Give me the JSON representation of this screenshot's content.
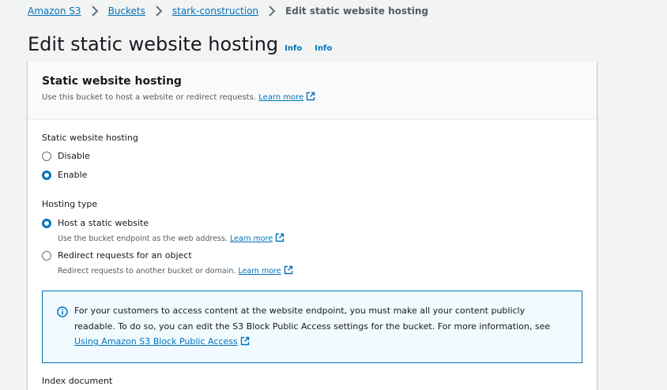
{
  "breadcrumb": {
    "items": [
      "Amazon S3",
      "Buckets",
      "stark-construction"
    ],
    "current": "Edit static website hosting"
  },
  "page": {
    "title": "Edit static website hosting",
    "info_links": [
      "Info",
      "Info"
    ]
  },
  "panel": {
    "title": "Static website hosting",
    "description": "Use this bucket to host a website or redirect requests.",
    "learn_more": "Learn more"
  },
  "hosting": {
    "label": "Static website hosting",
    "options": [
      "Disable",
      "Enable"
    ],
    "selected": "Enable"
  },
  "hosting_type": {
    "label": "Hosting type",
    "options": [
      {
        "label": "Host a static website",
        "desc": "Use the bucket endpoint as the web address.",
        "link": "Learn more"
      },
      {
        "label": "Redirect requests for an object",
        "desc": "Redirect requests to another bucket or domain.",
        "link": "Learn more"
      }
    ],
    "selected": "Host a static website"
  },
  "alert": {
    "text": "For your customers to access content at the website endpoint, you must make all your content publicly readable. To do so, you can edit the S3 Block Public Access settings for the bucket. For more information, see",
    "link": "Using Amazon S3 Block Public Access"
  },
  "index_document": {
    "label": "Index document"
  },
  "colors": {
    "link": "#0073bb",
    "background": "#f2f3f3",
    "alert_bg": "#f1faff",
    "alert_border": "#0073bb"
  }
}
